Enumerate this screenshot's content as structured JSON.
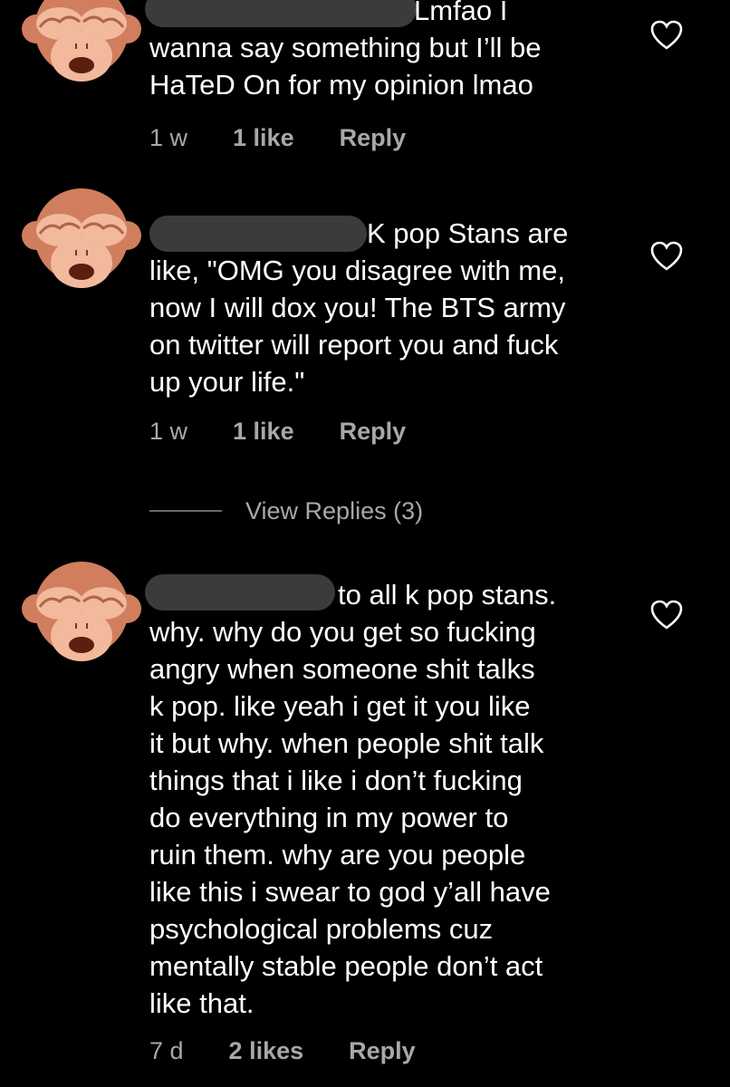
{
  "colors": {
    "background": "#000000",
    "text": "#ffffff",
    "meta": "#a8a8a8",
    "redaction": "#3b3b3b",
    "avatar_fur": "#d07e5e",
    "avatar_face": "#f2b99d"
  },
  "comments": [
    {
      "avatar_icon": "see-no-evil-monkey-icon",
      "lines": [
        "Lmfao I",
        "wanna say something but I’ll be",
        "HaTeD On for my opinion lmao"
      ],
      "time": "1 w",
      "likes": "1 like",
      "reply": "Reply",
      "like_icon": "heart-outline-icon"
    },
    {
      "avatar_icon": "see-no-evil-monkey-icon",
      "lines": [
        "K pop Stans are",
        "like, \"OMG you disagree with me,",
        "now I will dox you! The BTS army",
        "on twitter will report you and fuck",
        "up your life.\""
      ],
      "time": "1 w",
      "likes": "1 like",
      "reply": "Reply",
      "like_icon": "heart-outline-icon"
    },
    {
      "avatar_icon": "see-no-evil-monkey-icon",
      "lines": [
        "to all k pop stans.",
        "why. why do you get so fucking",
        "angry when someone shit talks",
        "k pop. like yeah i get it you like",
        "it but why. when people shit talk",
        "things that i like i don’t fucking",
        "do everything in my power to",
        "ruin them. why are you people",
        "like this i swear to god y’all have",
        "psychological problems cuz",
        "mentally stable people don’t act",
        "like that."
      ],
      "time": "7 d",
      "likes": "2 likes",
      "reply": "Reply",
      "like_icon": "heart-outline-icon"
    }
  ],
  "view_replies": {
    "label": "View Replies (3)"
  }
}
